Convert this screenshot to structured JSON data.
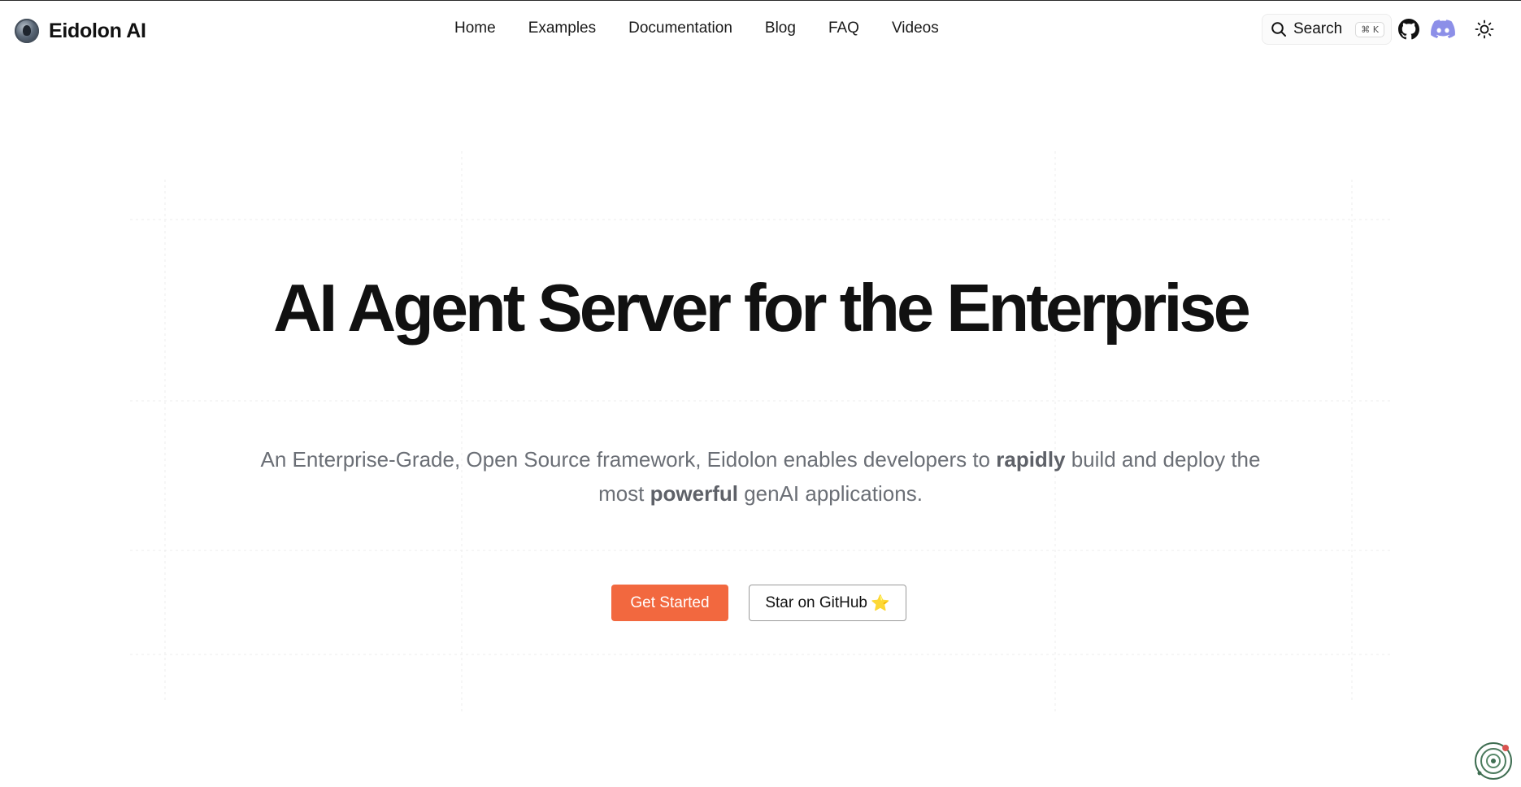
{
  "brand": {
    "name": "Eidolon AI",
    "logo_icon": "avatar-logo-icon"
  },
  "nav": {
    "items": [
      {
        "label": "Home"
      },
      {
        "label": "Examples"
      },
      {
        "label": "Documentation"
      },
      {
        "label": "Blog"
      },
      {
        "label": "FAQ"
      },
      {
        "label": "Videos"
      }
    ]
  },
  "search": {
    "label": "Search",
    "shortcut": "⌘ K",
    "icon": "search-icon"
  },
  "header_icons": {
    "github": "github-icon",
    "discord": "discord-icon",
    "theme": "sun-icon"
  },
  "hero": {
    "title": "AI Agent Server for the Enterprise",
    "subtitle_part1": "An Enterprise-Grade, Open Source framework, Eidolon enables developers to ",
    "subtitle_bold1": "rapidly",
    "subtitle_part2": " build and deploy the most ",
    "subtitle_bold2": "powerful",
    "subtitle_part3": " genAI applications."
  },
  "cta": {
    "primary_label": "Get Started",
    "secondary_label": "Star on GitHub",
    "secondary_icon": "star-icon",
    "star_glyph": "⭐"
  },
  "colors": {
    "accent": "#f2683f",
    "text": "#111111",
    "muted": "#6b6f76",
    "discord": "#8c8fe8"
  },
  "widget": {
    "icon": "orbit-widget-icon"
  }
}
